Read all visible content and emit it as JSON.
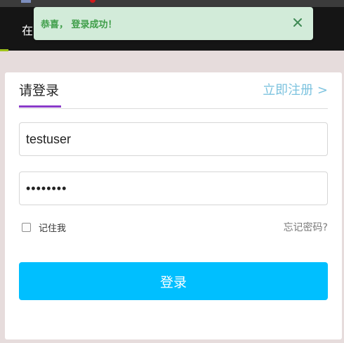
{
  "header": {
    "partial_text": "在"
  },
  "toast": {
    "message": "恭喜， 登录成功！"
  },
  "login": {
    "tab_login": "请登录",
    "tab_register": "立即注册 >",
    "username_value": "testuser",
    "password_value": "password",
    "remember_label": "记住我",
    "forgot_label": "忘记密码?",
    "submit_label": "登录"
  },
  "colors": {
    "toast_bg": "#d2ebd9",
    "toast_text": "#3f9e49",
    "accent_underline": "#8a3bc9",
    "register_link": "#7dc3df",
    "submit_bg": "#00bfff"
  }
}
